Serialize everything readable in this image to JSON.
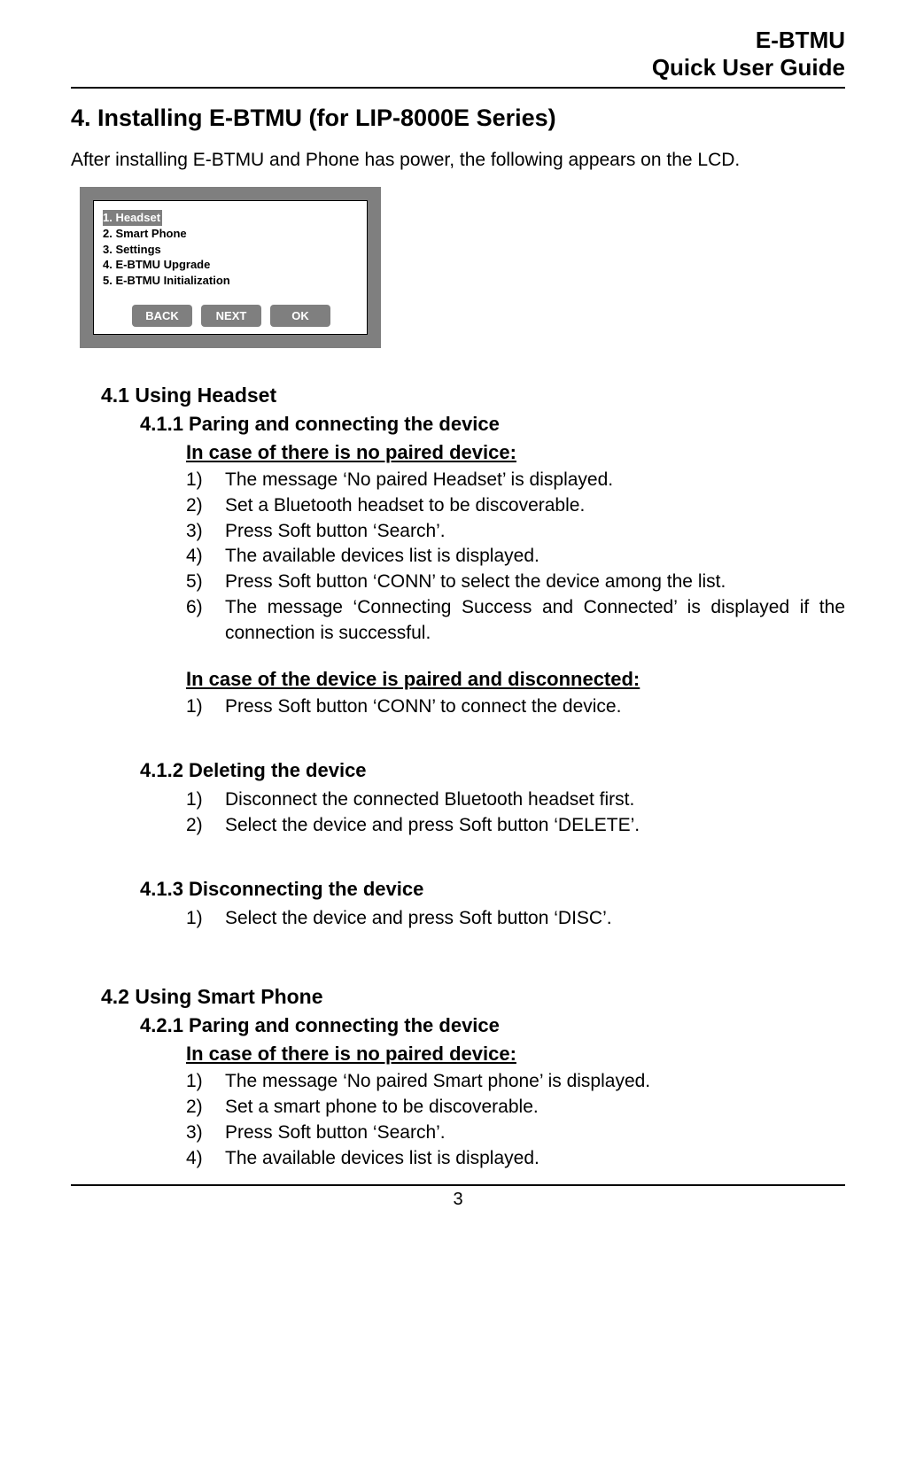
{
  "header": {
    "line1": "E-BTMU",
    "line2": "Quick User Guide"
  },
  "section": {
    "title": "4.  Installing E-BTMU (for LIP-8000E Series)",
    "intro": "After installing E-BTMU and Phone has power, the following appears on the LCD."
  },
  "lcd": {
    "menu": [
      "1.  Headset",
      "2.  Smart Phone",
      "3.  Settings",
      "4.  E-BTMU Upgrade",
      "5.  E-BTMU Initialization"
    ],
    "buttons": {
      "back": "BACK",
      "next": "NEXT",
      "ok": "OK"
    }
  },
  "s41": {
    "title": "4.1   Using Headset",
    "s411": {
      "title": "4.1.1 Paring and connecting the device",
      "caseA": {
        "heading": "In case of there is no paired device:",
        "steps": [
          "The message ‘No paired Headset’ is displayed.",
          "Set a Bluetooth headset to be discoverable.",
          "Press Soft button ‘Search’.",
          "The available devices list is displayed.",
          "Press Soft button ‘CONN’ to select the device among the list.",
          "The message ‘Connecting Success and Connected’ is displayed if the connection is successful."
        ]
      },
      "caseB": {
        "heading": "In case of the device is paired and disconnected:",
        "steps": [
          "Press Soft button ‘CONN’ to connect the device."
        ]
      }
    },
    "s412": {
      "title": "4.1.2 Deleting the device",
      "steps": [
        "Disconnect the connected Bluetooth headset first.",
        "Select the device and press Soft button ‘DELETE’."
      ]
    },
    "s413": {
      "title": "4.1.3 Disconnecting the device",
      "steps": [
        "Select the device and press Soft button ‘DISC’."
      ]
    }
  },
  "s42": {
    "title": "4.2   Using Smart Phone",
    "s421": {
      "title": "4.2.1 Paring and connecting the device",
      "caseA": {
        "heading": "In case of there is no paired device:",
        "steps": [
          "The message ‘No paired Smart phone’ is displayed.",
          "Set a smart phone to be discoverable.",
          "Press Soft button ‘Search’.",
          "The available devices list is displayed."
        ]
      }
    }
  },
  "page_number": "3",
  "nums": {
    "n1": "1)",
    "n2": "2)",
    "n3": "3)",
    "n4": "4)",
    "n5": "5)",
    "n6": "6)"
  }
}
